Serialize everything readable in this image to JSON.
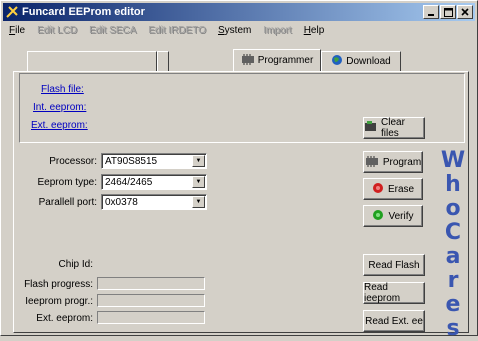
{
  "window": {
    "title": "Funcard EEProm editor"
  },
  "menu": [
    {
      "label": "File",
      "key": "F",
      "rest": "ile",
      "disabled": false
    },
    {
      "label": "Edit LCD",
      "key": "",
      "rest": "Edit LCD",
      "disabled": true
    },
    {
      "label": "Edit SECA",
      "key": "",
      "rest": "Edit SECA",
      "disabled": true
    },
    {
      "label": "Edit IRDETO",
      "key": "",
      "rest": "Edit IRDETO",
      "disabled": true
    },
    {
      "label": "System",
      "key": "S",
      "rest": "ystem",
      "disabled": false
    },
    {
      "label": "Import",
      "key": "",
      "rest": "Import",
      "disabled": true
    },
    {
      "label": "Help",
      "key": "H",
      "rest": "elp",
      "disabled": false
    }
  ],
  "tabs": {
    "programmer": "Programmer",
    "download": "Download"
  },
  "files": {
    "flash": "Flash file:",
    "int_eeprom": "Int. eeprom:",
    "ext_eeprom": "Ext. eeprom:"
  },
  "buttons": {
    "clear_files": "Clear files",
    "program": "Program",
    "erase": "Erase",
    "verify": "Verify",
    "read_flash": "Read Flash",
    "read_ieeprom": "Read ieeprom",
    "read_ext_ee": "Read Ext. ee"
  },
  "fields": {
    "processor_label": "Processor:",
    "processor_value": "AT90S8515",
    "eeprom_type_label": "Eeprom type:",
    "eeprom_type_value": "2464/2465",
    "parallel_port_label": "Parallell port:",
    "parallel_port_value": "0x0378"
  },
  "status": {
    "chip_id_label": "Chip Id:",
    "flash_progress_label": "Flash progress:",
    "ieeprom_progress_label": "Ieeprom progr.:",
    "ext_eeprom_label": "Ext. eeprom:"
  },
  "watermark": [
    "W",
    "h",
    "o",
    "C",
    "a",
    "r",
    "e",
    "s"
  ],
  "colors": {
    "titlebar_start": "#0a246a",
    "titlebar_end": "#a6caf0",
    "link": "#0000c0",
    "watermark": "#3a56b0"
  }
}
